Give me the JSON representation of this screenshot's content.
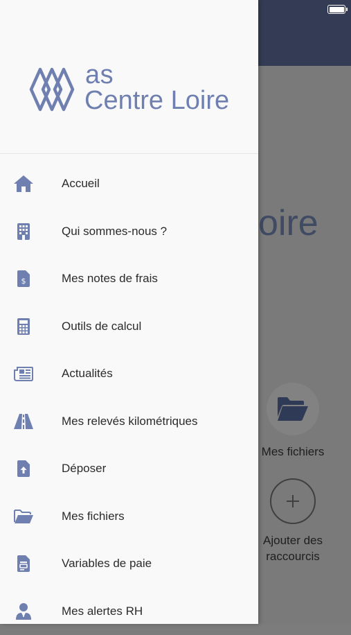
{
  "background": {
    "logo_fragment": "oire",
    "tiles": [
      {
        "label": "Mes fichiers",
        "icon": "folder-open-icon"
      },
      {
        "label": "Ajouter des raccourcis",
        "icon": "plus-icon"
      }
    ]
  },
  "drawer": {
    "logo": {
      "line1": "as",
      "line2": "Centre Loire"
    },
    "items": [
      {
        "label": "Accueil",
        "icon": "home-icon"
      },
      {
        "label": "Qui sommes-nous ?",
        "icon": "building-icon"
      },
      {
        "label": "Mes notes de frais",
        "icon": "receipt-dollar-icon"
      },
      {
        "label": "Outils de calcul",
        "icon": "calculator-icon"
      },
      {
        "label": "Actualités",
        "icon": "newspaper-icon"
      },
      {
        "label": "Mes relevés kilométriques",
        "icon": "road-icon"
      },
      {
        "label": "Déposer",
        "icon": "file-upload-icon"
      },
      {
        "label": "Mes fichiers",
        "icon": "folder-open-icon"
      },
      {
        "label": "Variables de paie",
        "icon": "file-lines-icon"
      },
      {
        "label": "Mes alertes RH",
        "icon": "user-tie-icon"
      }
    ]
  },
  "colors": {
    "accent": "#6f7fb0",
    "header_dark": "#333c54",
    "drawer_bg": "#f9f9f9",
    "overlay": "#7a7a7a"
  }
}
